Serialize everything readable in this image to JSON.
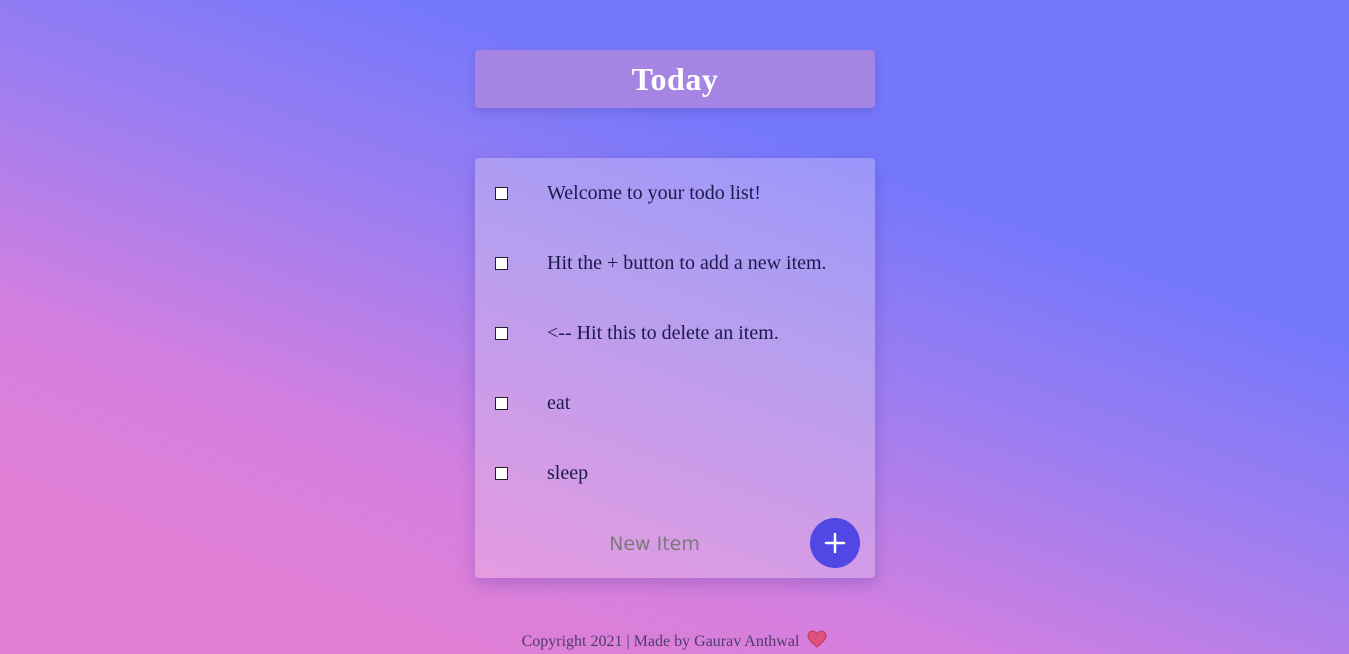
{
  "header": {
    "title": "Today"
  },
  "items": [
    {
      "text": "Welcome to your todo list!",
      "checked": false
    },
    {
      "text": "Hit the + button to add a new item.",
      "checked": false
    },
    {
      "text": "<-- Hit this to delete an item.",
      "checked": false
    },
    {
      "text": "eat",
      "checked": false
    },
    {
      "text": "sleep",
      "checked": false
    }
  ],
  "new_item": {
    "placeholder": "New Item",
    "value": "",
    "add_icon": "plus-icon"
  },
  "footer": {
    "text": "Copyright 2021 | Made by Gaurav Anthwal",
    "icon": "heart-icon"
  },
  "colors": {
    "accent": "#5047e5",
    "header_bg": "#a584e3",
    "text": "#1c1a4d"
  }
}
